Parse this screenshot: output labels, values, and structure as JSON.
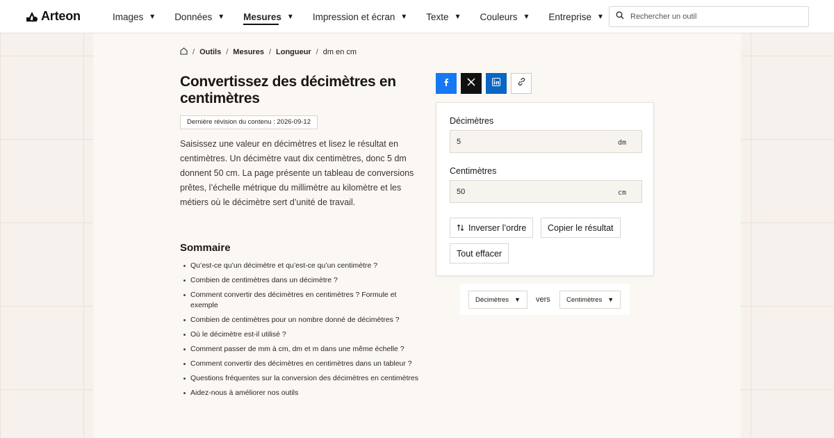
{
  "brand": {
    "name": "Arteon"
  },
  "nav": {
    "items": [
      {
        "label": "Images",
        "caret": "▼",
        "active": false
      },
      {
        "label": "Données",
        "caret": "▼",
        "active": false
      },
      {
        "label": "Mesures",
        "caret": "▼",
        "active": true
      },
      {
        "label": "Impression et écran",
        "caret": "▼",
        "active": false
      },
      {
        "label": "Texte",
        "caret": "▼",
        "active": false
      },
      {
        "label": "Couleurs",
        "caret": "▼",
        "active": false
      },
      {
        "label": "Entreprise",
        "caret": "▼",
        "active": false
      }
    ]
  },
  "search": {
    "placeholder": "Rechercher un outil"
  },
  "breadcrumb": {
    "separator": "/",
    "items": [
      "Outils",
      "Mesures",
      "Longueur"
    ],
    "current": "dm en cm"
  },
  "page": {
    "title": "Convertissez des décimètres en centimètres",
    "revision": "Dernière révision du contenu : 2026-09-12",
    "intro": "Saisissez une valeur en décimètres et lisez le résultat en centimètres. Un décimètre vaut dix centimètres, donc 5 dm donnent 50 cm. La page présente un tableau de conversions prêtes, l’échelle métrique du millimètre au kilomètre et les métiers où le décimètre sert d’unité de travail."
  },
  "summary": {
    "title": "Sommaire",
    "items": [
      "Qu’est-ce qu’un décimètre et qu’est-ce qu’un centimètre ?",
      "Combien de centimètres dans un décimètre ?",
      "Comment convertir des décimètres en centimètres ? Formule et exemple",
      "Combien de centimètres pour un nombre donné de décimètres ?",
      "Où le décimètre est-il utilisé ?",
      "Comment passer de mm à cm, dm et m dans une même échelle ?",
      "Comment convertir des décimètres en centimètres dans un tableur ?",
      "Questions fréquentes sur la conversion des décimètres en centimètres",
      "Aidez-nous à améliorer nos outils"
    ]
  },
  "share": {
    "icons": [
      "facebook-icon",
      "x-icon",
      "linkedin-icon",
      "link-icon"
    ],
    "colors": {
      "facebook": "#1877f2",
      "x": "#111111",
      "linkedin": "#0a66c2"
    }
  },
  "converter": {
    "from": {
      "label": "Décimètres",
      "value": "5",
      "unit": "dm"
    },
    "to": {
      "label": "Centimètres",
      "value": "50",
      "unit": "cm"
    },
    "actions": {
      "swap": "Inverser l’ordre",
      "copy": "Copier le résultat",
      "clear": "Tout effacer"
    }
  },
  "unit_selector": {
    "from": "Décimètres",
    "to": "Centimètres",
    "connector": "vers",
    "caret": "▼"
  }
}
